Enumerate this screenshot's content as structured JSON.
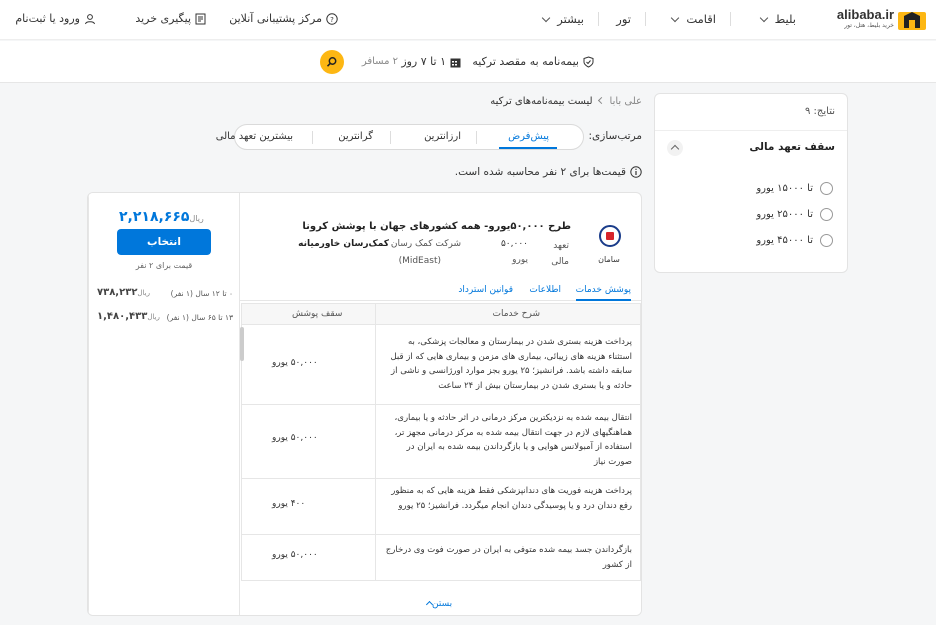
{
  "brand": {
    "name": "alibaba.ir",
    "tagline": "خرید بلیط، هتل، تور",
    "colors": {
      "yellow": "#fdb713",
      "blue": "#0077db"
    }
  },
  "nav": {
    "items": [
      "بلیط",
      "اقامت",
      "تور",
      "بیشتر"
    ]
  },
  "top_links": {
    "support": "مرکز پشتیبانی آنلاین",
    "track": "پیگیری خرید",
    "login": "ورود یا ثبت‌نام"
  },
  "search_summary": {
    "destination": "بیمه‌نامه به مقصد ترکیه",
    "duration": "۱ تا ۷ روز",
    "passengers": "۲ مسافر"
  },
  "filters": {
    "results": "نتایج: ۹",
    "cap_title": "سقف تعهد مالی",
    "options": [
      "تا ۱۵۰۰۰ یورو",
      "تا ۲۵۰۰۰ یورو",
      "تا ۴۵۰۰۰ یورو"
    ]
  },
  "breadcrumb": {
    "home": "علی بابا",
    "current": "لیست بیمه‌نامه‌های ترکیه"
  },
  "sort": {
    "label": "مرتب‌سازی:",
    "options": [
      "پیش‌فرض",
      "ارزانترین",
      "گرانترین",
      "بیشترین تعهد مالی"
    ],
    "active": "پیش‌فرض"
  },
  "notice": "قیمت‌ها برای ۲ نفر محاسبه شده است.",
  "card": {
    "price": "۲,۲۱۸,۶۶۵",
    "currency": "ریال",
    "select_label": "انتخاب",
    "price_note": "قیمت برای ۲ نفر",
    "ages": [
      {
        "label": "۰ تا ۱۲ سال (۱ نفر)",
        "value": "۷۳۸,۲۳۲",
        "currency": "ریال"
      },
      {
        "label": "۱۳ تا ۶۵ سال (۱ نفر)",
        "value": "۱,۴۸۰,۴۳۳",
        "currency": "ریال"
      }
    ],
    "insurer": "سامان",
    "plan_title": "طرح ۵۰,۰۰۰یورو- همه کشورهای جهان با پوشش کرونا",
    "commitment_label": "تعهد",
    "commitment_value": "۵۰,۰۰۰",
    "currency_label": "مالی",
    "currency_value": "یورو",
    "assistance_label": "شرکت کمک رسان",
    "assistance_value": "کمک‌رسان خاورمیانه",
    "assistance_code": "(MidEast)",
    "tabs": [
      "پوشش خدمات",
      "اطلاعات",
      "قوانین استرداد"
    ],
    "table_headers": {
      "desc": "شرح خدمات",
      "cap": "سقف پوشش"
    },
    "services": [
      {
        "desc": "پرداخت هزینه بستری شدن در بیمارستان و معالجات پزشکی، به استثناء هزینه های زیبائی، بیماری های مزمن و بیماری هایی که از قبل سابقه داشته باشد. فرانشیز؛ ۲۵ یورو بجز موارد اورژانسی و ناشی از حادثه و یا بستری شدن در بیمارستان بیش از ۲۴ ساعت",
        "cap": "۵۰,۰۰۰ یورو"
      },
      {
        "desc": "انتقال بیمه شده به نزدیکترین مرکز درمانی در اثر حادثه و یا بیماری، هماهنگیهای لازم در جهت انتقال بیمه شده به مرکز درمانی مجهز تر، استفاده از آمبولانس هوایی و یا بازگرداندن بیمه شده به ایران در صورت نیاز",
        "cap": "۵۰,۰۰۰ یورو"
      },
      {
        "desc": "پرداخت هزینه فوریت های دندانپزشکی فقط هزینه هایی که به منظور رفع دندان درد و یا پوسیدگی دندان انجام میگردد. فرانشیز؛ ۲۵ یورو",
        "cap": "۴۰۰ یورو"
      },
      {
        "desc": "بازگرداندن جسد بیمه شده متوفی به ایران در صورت فوت وی درخارج از کشور",
        "cap": "۵۰,۰۰۰ یورو"
      }
    ],
    "close_label": "بستن"
  }
}
